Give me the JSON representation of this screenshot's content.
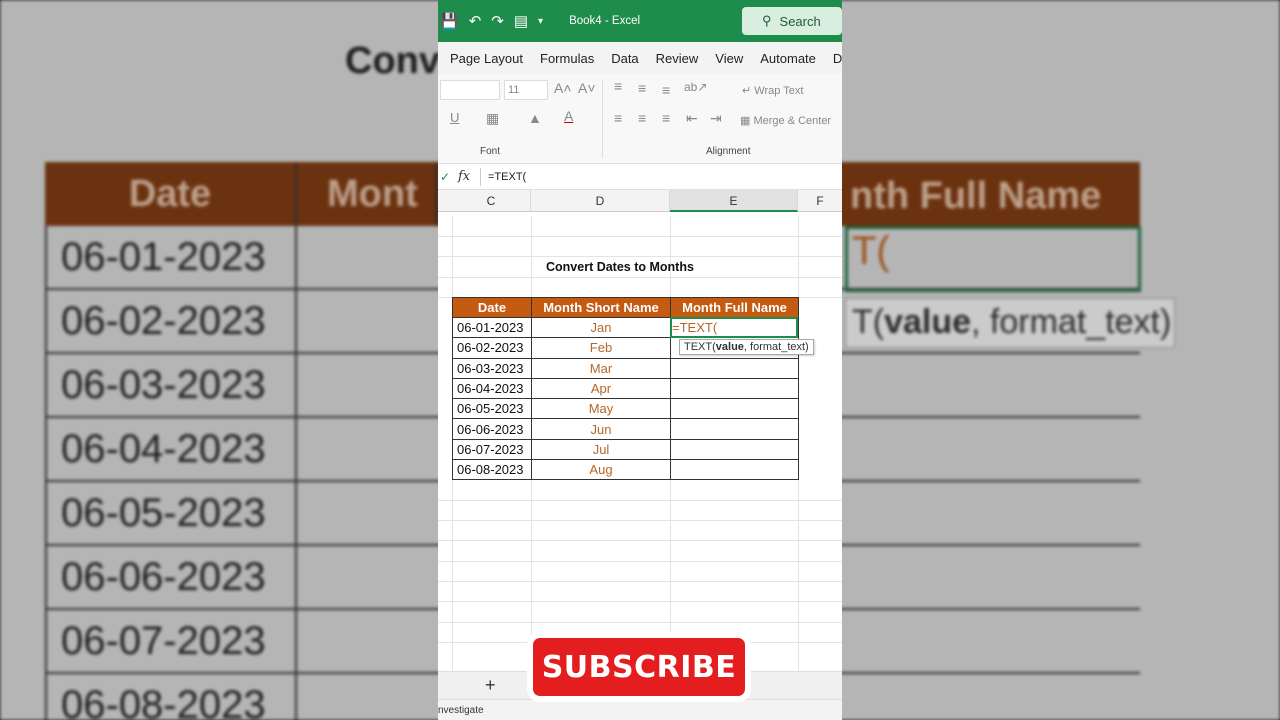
{
  "app": {
    "doc_title": "Book4",
    "app_name": "Excel",
    "sep": "-"
  },
  "search": {
    "label": "Search"
  },
  "ribbon_tabs": [
    "Page Layout",
    "Formulas",
    "Data",
    "Review",
    "View",
    "Automate",
    "Deve"
  ],
  "ribbon": {
    "font_size": "11",
    "font_group": "Font",
    "alignment_group": "Alignment",
    "wrap_text": "Wrap Text",
    "merge_center": "Merge & Center"
  },
  "formula_bar": {
    "fx": "fx",
    "value": "=TEXT("
  },
  "columns": [
    "C",
    "D",
    "E",
    "F"
  ],
  "sheet": {
    "title": "Convert Dates to Months",
    "headers": [
      "Date",
      "Month Short Name",
      "Month Full Name"
    ],
    "rows": [
      {
        "date": "06-01-2023",
        "short": "Jan"
      },
      {
        "date": "06-02-2023",
        "short": "Feb"
      },
      {
        "date": "06-03-2023",
        "short": "Mar"
      },
      {
        "date": "06-04-2023",
        "short": "Apr"
      },
      {
        "date": "06-05-2023",
        "short": "May"
      },
      {
        "date": "06-06-2023",
        "short": "Jun"
      },
      {
        "date": "06-07-2023",
        "short": "Jul"
      },
      {
        "date": "06-08-2023",
        "short": "Aug"
      }
    ],
    "active_cell_text": "=TEXT(",
    "tooltip_fn": "TEXT(",
    "tooltip_arg1": "value",
    "tooltip_rest": ", format_text)"
  },
  "sheet_bar": {
    "add": "+"
  },
  "status": {
    "text": "nvestigate"
  },
  "overlay": {
    "subscribe": "SUBSCRIBE"
  },
  "background": {
    "title": "Conv",
    "header_date": "Date",
    "header_month": "Mont",
    "header_full": "nth Full Name",
    "formula": "T(",
    "tooltip_value": "value",
    "tooltip_rest": ", format_text)",
    "tooltip_prefix": "T("
  },
  "colors": {
    "excel_green": "#1e8c4a",
    "header_orange": "#c55a11",
    "month_text": "#b4672a",
    "subscribe_red": "#e41e1e"
  }
}
